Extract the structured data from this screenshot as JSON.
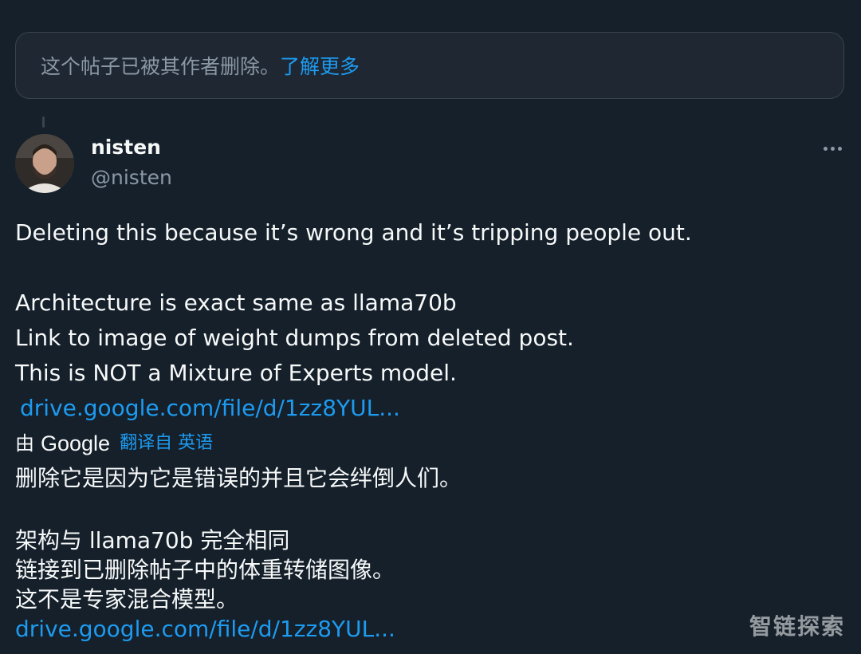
{
  "deleted_notice": {
    "text": "这个帖子已被其作者删除。",
    "learn_more": "了解更多"
  },
  "author": {
    "name": "nisten",
    "handle": "@nisten"
  },
  "post": {
    "line1": "Deleting this because it’s wrong and it’s tripping people out.",
    "line2": "Architecture is exact same as llama70b",
    "line3": "Link to image of weight dumps from deleted post.",
    "line4": "This is NOT a Mixture of Experts model.",
    "link": "drive.google.com/file/d/1zz8YUL..."
  },
  "translation": {
    "by": "由",
    "provider": "Google",
    "label": "翻译自 英语",
    "line1": "删除它是因为它是错误的并且它会绊倒人们。",
    "line2": "架构与 llama70b 完全相同",
    "line3": "链接到已删除帖子中的体重转储图像。",
    "line4": "这不是专家混合模型。",
    "link": "drive.google.com/file/d/1zz8YUL..."
  },
  "watermark": "智链探索",
  "colors": {
    "background": "#15202b",
    "link": "#1d9bf0",
    "muted": "#8b98a5",
    "text": "#f7f9f9"
  },
  "icons": {
    "more": "more-horizontal-icon"
  }
}
